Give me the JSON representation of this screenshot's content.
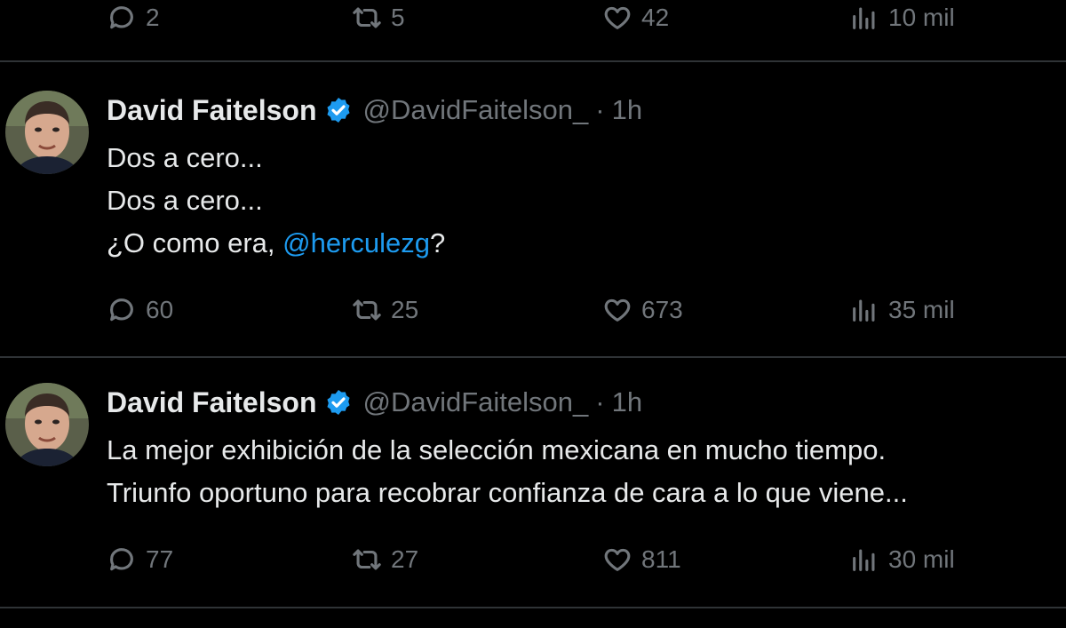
{
  "tweets": [
    {
      "stats": {
        "replies": "2",
        "retweets": "5",
        "likes": "42",
        "views": "10 mil"
      }
    },
    {
      "author": {
        "name": "David Faitelson",
        "handle": "@DavidFaitelson_",
        "separator": "·",
        "time": "1h"
      },
      "text": {
        "line1": "Dos a cero...",
        "line2": "Dos a cero...",
        "line3_before": "¿O como era, ",
        "mention": "@herculezg",
        "line3_after": "?"
      },
      "stats": {
        "replies": "60",
        "retweets": "25",
        "likes": "673",
        "views": "35 mil"
      }
    },
    {
      "author": {
        "name": "David Faitelson",
        "handle": "@DavidFaitelson_",
        "separator": "·",
        "time": "1h"
      },
      "text": {
        "line1": "La mejor exhibición de la selección mexicana en mucho tiempo.",
        "line2": "Triunfo oportuno para recobrar confianza de cara a lo que viene..."
      },
      "stats": {
        "replies": "77",
        "retweets": "27",
        "likes": "811",
        "views": "30 mil"
      }
    }
  ],
  "colors": {
    "background": "#000000",
    "text": "#e7e9ea",
    "muted": "#71767b",
    "accent": "#1d9bf0",
    "divider": "#2f3336"
  },
  "icons": {
    "reply": "speech-bubble-icon",
    "retweet": "retweet-arrows-icon",
    "like": "heart-icon",
    "views": "bar-chart-icon",
    "verified": "verified-badge-icon"
  }
}
